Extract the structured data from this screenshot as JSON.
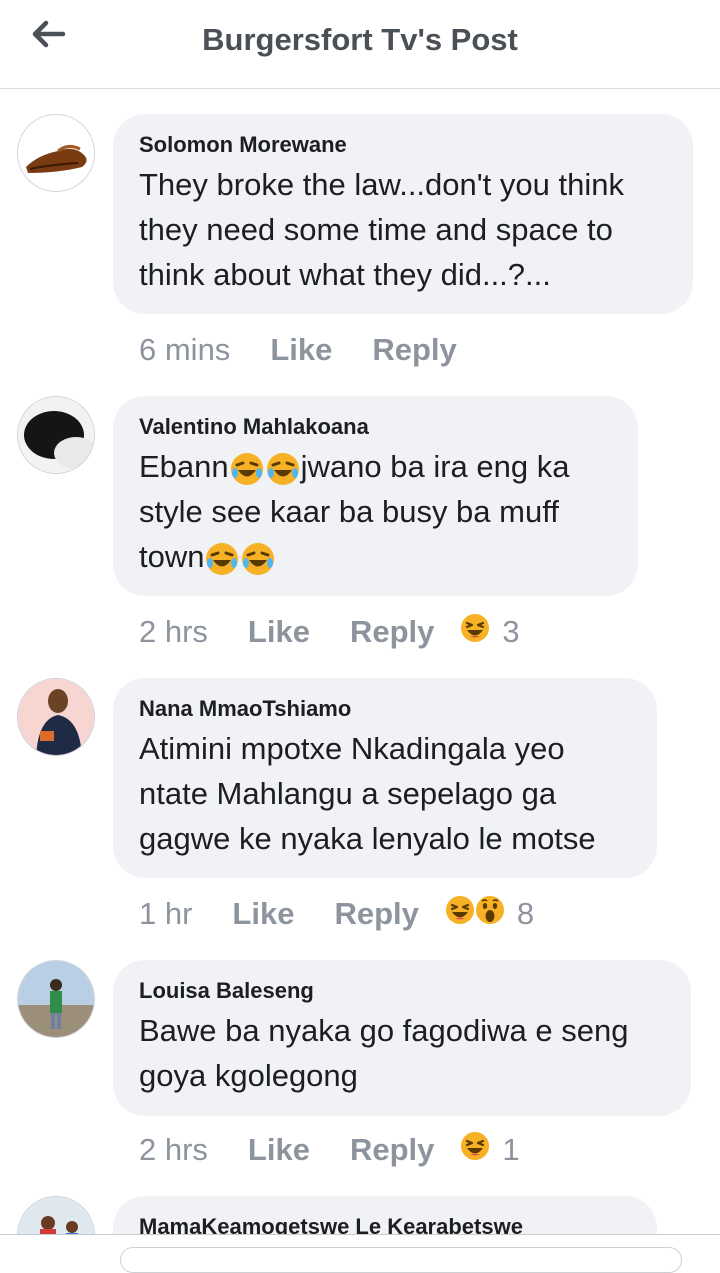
{
  "header": {
    "title": "Burgersfort Tv's Post",
    "back_icon": "arrow-left-icon"
  },
  "comments": [
    {
      "author": "Solomon Morewane",
      "text": "They broke the law...don't you think they need some time and space to think about what they did...?...",
      "time": "6 mins",
      "like": "Like",
      "reply": "Reply"
    },
    {
      "author": "Valentino Mahlakoana",
      "text_parts": [
        "Ebann",
        "jwano ba ira eng ka style see kaar ba busy ba muff town"
      ],
      "time": "2 hrs",
      "like": "Like",
      "reply": "Reply",
      "reaction_count": "3"
    },
    {
      "author": "Nana MmaoTshiamo",
      "text": "Atimini mpotxe Nkadingala yeo ntate Mahlangu a sepelago ga gagwe ke nyaka lenyalo le motse",
      "time": "1 hr",
      "like": "Like",
      "reply": "Reply",
      "reaction_count": "8"
    },
    {
      "author": "Louisa Baleseng",
      "text": "Bawe ba nyaka go fagodiwa e seng goya kgolegong",
      "time": "2 hrs",
      "like": "Like",
      "reply": "Reply",
      "reaction_count": "1"
    },
    {
      "author": "MamaKeamogetswe Le Kearabetswe"
    }
  ],
  "colors": {
    "bubble": "#f0f2f5",
    "meta": "#8d949e",
    "haha": "#f7b125"
  }
}
